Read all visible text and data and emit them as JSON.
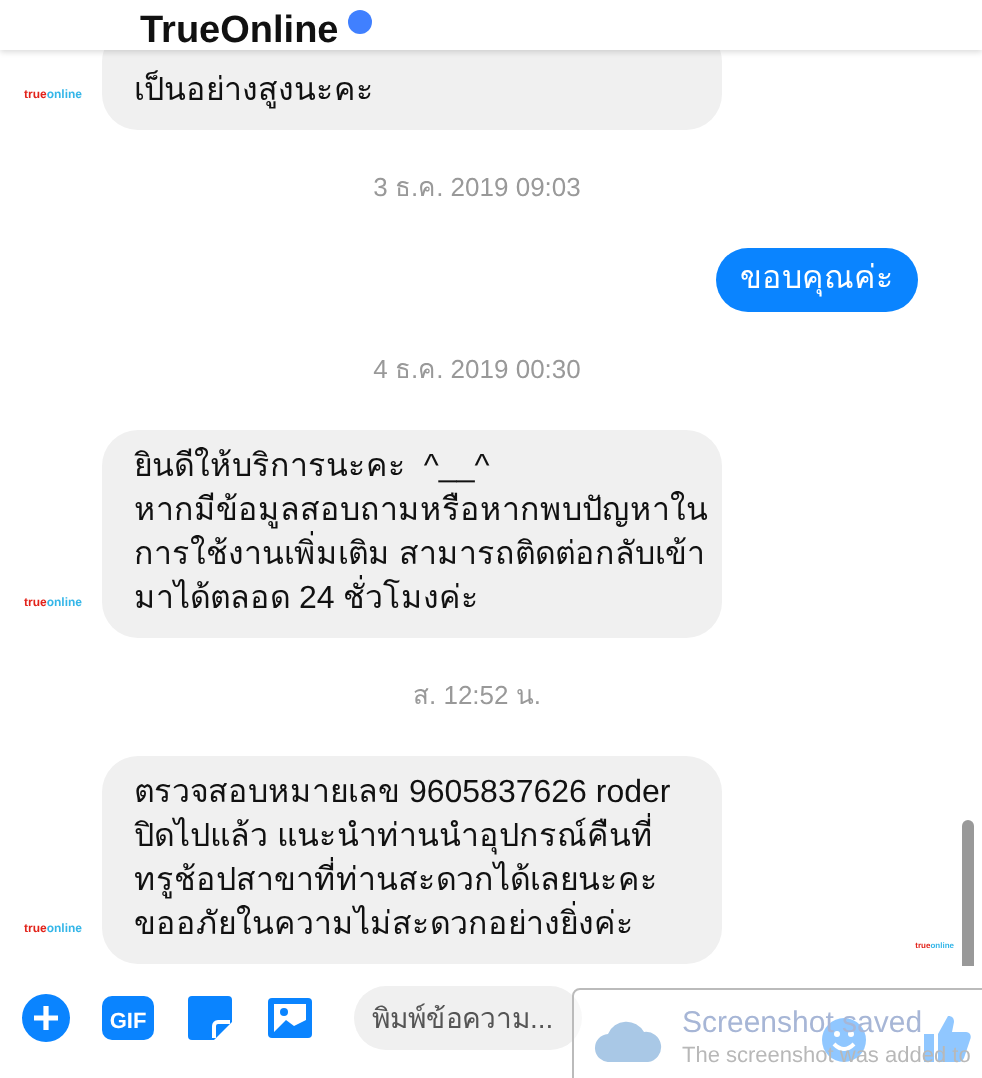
{
  "header": {
    "title": "TrueOnline",
    "verified": true
  },
  "messages": [
    {
      "kind": "incoming",
      "text": "เป็นอย่างสูงนะคะ",
      "avatar": [
        "true",
        "online"
      ]
    },
    {
      "kind": "time",
      "text": "3 ธ.ค. 2019 09:03"
    },
    {
      "kind": "outgoing",
      "text": "ขอบคุณค่ะ"
    },
    {
      "kind": "time",
      "text": "4 ธ.ค. 2019 00:30"
    },
    {
      "kind": "incoming",
      "text": "ยินดีให้บริการนะคะ  ^__^\nหากมีข้อมูลสอบถามหรือหากพบปัญหาใน\nการใช้งานเพิ่มเติม สามารถติดต่อกลับเข้า\nมาได้ตลอด 24 ชั่วโมงค่ะ",
      "avatar": [
        "true",
        "online"
      ]
    },
    {
      "kind": "time",
      "text": "ส. 12:52 น."
    },
    {
      "kind": "incoming",
      "text": "ตรวจสอบหมายเลข 9605837626 roder\nปิดไปแล้ว แนะนำท่านนำอุปกรณ์คืนที่\nทรูช้อปสาขาที่ท่านสะดวกได้เลยนะคะ\nขออภัยในความไม่สะดวกอย่างยิ่งค่ะ",
      "avatar": [
        "true",
        "online"
      ],
      "seen": [
        "true",
        "online"
      ]
    }
  ],
  "composer": {
    "gif_label": "GIF",
    "placeholder": "พิมพ์ข้อความ..."
  },
  "toast": {
    "title": "Screenshot saved",
    "body": "The screenshot was added to"
  }
}
